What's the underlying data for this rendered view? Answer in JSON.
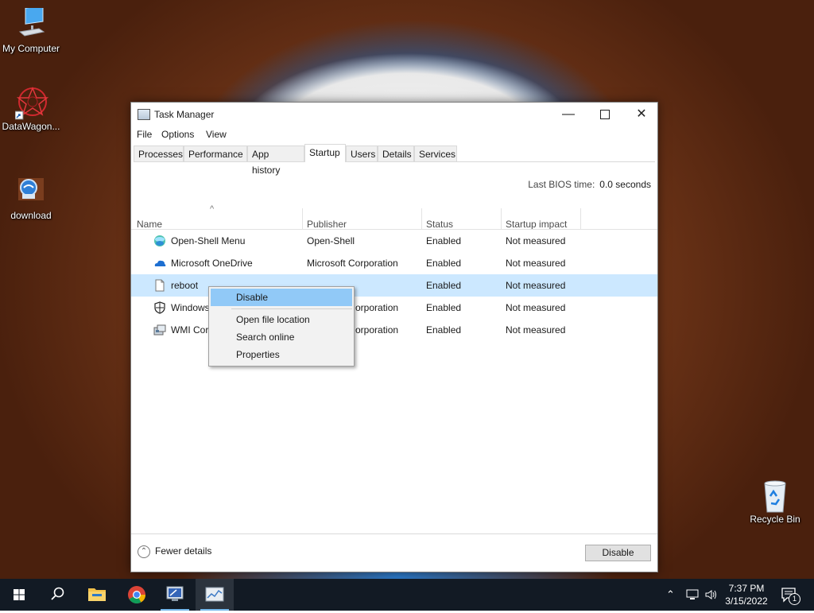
{
  "desktop": {
    "icons": [
      {
        "label": "My Computer",
        "icon": "computer-icon"
      },
      {
        "label": "DataWagon...",
        "icon": "datawagon-icon"
      },
      {
        "label": "download",
        "icon": "download-icon"
      },
      {
        "label": "Recycle Bin",
        "icon": "recycle-bin-icon"
      }
    ]
  },
  "window": {
    "title": "Task Manager",
    "menu": [
      "File",
      "Options",
      "View"
    ],
    "tabs": [
      "Processes",
      "Performance",
      "App history",
      "Startup",
      "Users",
      "Details",
      "Services"
    ],
    "active_tab": "Startup",
    "bios_label": "Last BIOS time:",
    "bios_value": "0.0 seconds",
    "columns": [
      "Name",
      "Publisher",
      "Status",
      "Startup impact"
    ],
    "sort_indicator": "^",
    "rows": [
      {
        "name": "Open-Shell Menu",
        "publisher": "Open-Shell",
        "status": "Enabled",
        "impact": "Not measured",
        "icon": "open-shell-icon"
      },
      {
        "name": "Microsoft OneDrive",
        "publisher": "Microsoft Corporation",
        "status": "Enabled",
        "impact": "Not measured",
        "icon": "onedrive-icon"
      },
      {
        "name": "reboot",
        "publisher": "",
        "status": "Enabled",
        "impact": "Not measured",
        "icon": "file-icon"
      },
      {
        "name": "Windows",
        "publisher": "orporation",
        "status": "Enabled",
        "impact": "Not measured",
        "icon": "shield-icon"
      },
      {
        "name": "WMI Cor",
        "publisher": "orporation",
        "status": "Enabled",
        "impact": "Not measured",
        "icon": "wmi-icon"
      }
    ],
    "selected_row": 2,
    "footer": {
      "fewer_details": "Fewer details",
      "disable_button": "Disable"
    }
  },
  "context_menu": {
    "items": [
      "Disable",
      "Open file location",
      "Search online",
      "Properties"
    ],
    "highlighted": "Disable"
  },
  "taskbar": {
    "clock_time": "7:37 PM",
    "clock_date": "3/15/2022",
    "notification_count": "1"
  },
  "colors": {
    "selection": "#cce8ff",
    "menu_highlight": "#91c9f7",
    "taskbar": "#121a24"
  }
}
